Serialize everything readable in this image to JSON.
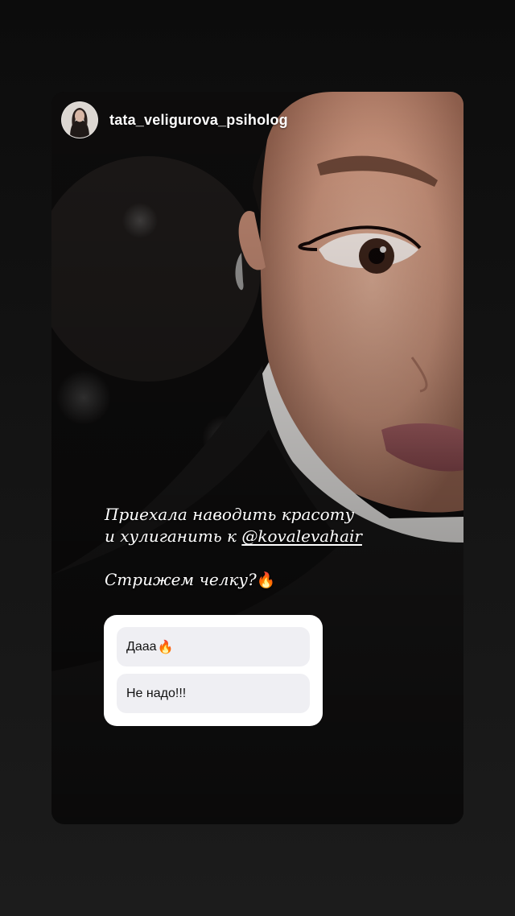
{
  "story": {
    "author": {
      "username": "tata_veligurova_psiholog"
    },
    "caption": {
      "line1": "Приехала наводить красоту",
      "line2_prefix": "и хулиганить к ",
      "mention": "@kovalevahair",
      "line3": "Стрижем челку?",
      "emoji": "🔥"
    },
    "poll": {
      "options": [
        {
          "label": "Дааа",
          "emoji": "🔥"
        },
        {
          "label": "Не надо!!!",
          "emoji": ""
        }
      ]
    }
  },
  "colors": {
    "page_bg": "#131313",
    "poll_bg": "#ffffff",
    "poll_option_bg": "#efeff3",
    "text_light": "#ffffff",
    "text_dark": "#111111"
  }
}
